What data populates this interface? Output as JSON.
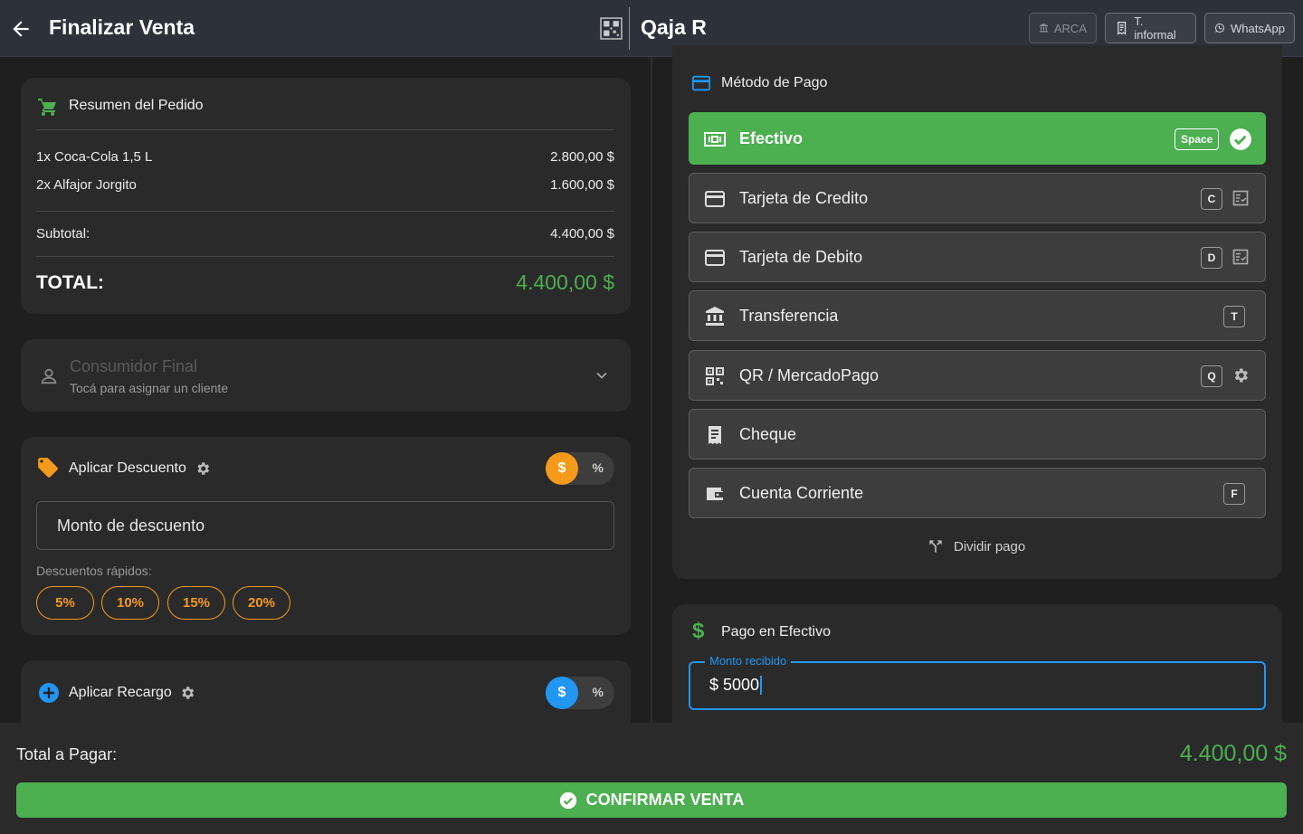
{
  "header": {
    "title": "Finalizar Venta",
    "brand": "Qaja R",
    "buttons": {
      "arca": "ARCA",
      "informal": "T. informal",
      "whatsapp": "WhatsApp"
    }
  },
  "order": {
    "title": "Resumen del Pedido",
    "items": [
      {
        "label": "1x Coca-Cola 1,5 L",
        "price": "2.800,00 $"
      },
      {
        "label": "2x Alfajor Jorgito",
        "price": "1.600,00 $"
      }
    ],
    "subtotal_label": "Subtotal:",
    "subtotal_value": "4.400,00 $",
    "total_label": "TOTAL:",
    "total_value": "4.400,00 $"
  },
  "customer": {
    "name": "Consumidor Final",
    "hint": "Tocá para asignar un cliente"
  },
  "discount": {
    "title": "Aplicar Descuento",
    "toggle_on": "$",
    "toggle_off": "%",
    "placeholder": "Monto de descuento",
    "quick_label": "Descuentos rápidos:",
    "quick": [
      "5%",
      "10%",
      "15%",
      "20%"
    ]
  },
  "surcharge": {
    "title": "Aplicar Recargo",
    "toggle_on": "$",
    "toggle_off": "%"
  },
  "payment": {
    "title": "Método de Pago",
    "methods": [
      {
        "label": "Efectivo",
        "key": "Space",
        "icon": "cash-icon",
        "selected": true
      },
      {
        "label": "Tarjeta de Credito",
        "key": "C",
        "icon": "credit-card-icon"
      },
      {
        "label": "Tarjeta de Debito",
        "key": "D",
        "icon": "debit-card-icon"
      },
      {
        "label": "Transferencia",
        "key": "T",
        "icon": "bank-icon"
      },
      {
        "label": "QR / MercadoPago",
        "key": "Q",
        "icon": "qr-icon"
      },
      {
        "label": "Cheque",
        "key": "",
        "icon": "receipt-icon"
      },
      {
        "label": "Cuenta Corriente",
        "key": "F",
        "icon": "wallet-icon"
      }
    ],
    "split": "Dividir pago"
  },
  "cash": {
    "title": "Pago en Efectivo",
    "field_label": "Monto recibido",
    "value": "$ 5000"
  },
  "footer": {
    "total_label": "Total a Pagar:",
    "total_value": "4.400,00 $",
    "confirm": "CONFIRMAR VENTA"
  },
  "colors": {
    "accent_green": "#4caf50",
    "accent_orange": "#f59a1b",
    "accent_blue": "#2196f3"
  }
}
